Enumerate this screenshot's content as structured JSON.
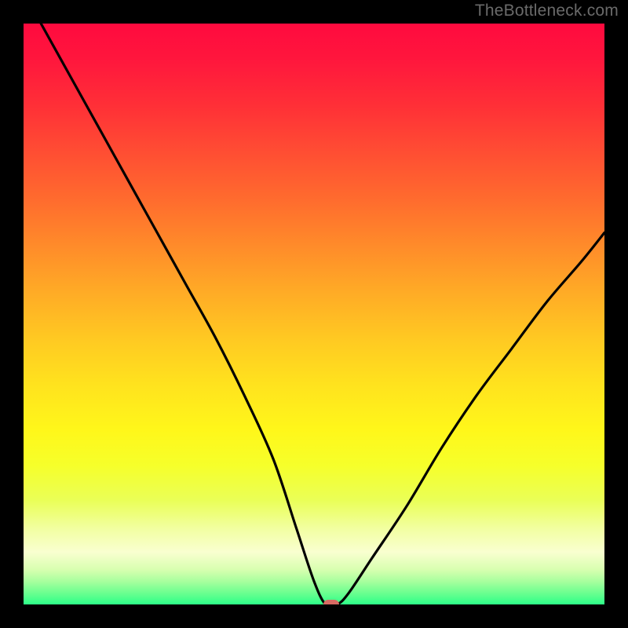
{
  "watermark": "TheBottleneck.com",
  "colors": {
    "frame_bg": "#000000",
    "curve_stroke": "#000000",
    "marker_fill": "#d86b63",
    "watermark_text": "#6a6a6a"
  },
  "chart_data": {
    "type": "line",
    "title": "",
    "xlabel": "",
    "ylabel": "",
    "xlim": [
      0,
      100
    ],
    "ylim": [
      0,
      100
    ],
    "grid": false,
    "legend": false,
    "background_gradient": {
      "direction": "vertical",
      "stops": [
        {
          "pos": 0,
          "color": "#ff0a3e"
        },
        {
          "pos": 50,
          "color": "#ffc822"
        },
        {
          "pos": 75,
          "color": "#f6ff2a"
        },
        {
          "pos": 100,
          "color": "#2dff88"
        }
      ]
    },
    "series": [
      {
        "name": "bottleneck-curve",
        "x": [
          3,
          8,
          13,
          18,
          23,
          28,
          33,
          38,
          43,
          47,
          50,
          52,
          54,
          56,
          60,
          66,
          72,
          78,
          84,
          90,
          96,
          100
        ],
        "y": [
          100,
          91,
          82,
          73,
          64,
          55,
          46,
          36,
          25,
          13,
          4,
          0,
          0,
          2,
          8,
          17,
          27,
          36,
          44,
          52,
          59,
          64
        ]
      }
    ],
    "marker": {
      "x": 53,
      "y": 0,
      "shape": "rounded-rect",
      "color": "#d86b63"
    }
  }
}
